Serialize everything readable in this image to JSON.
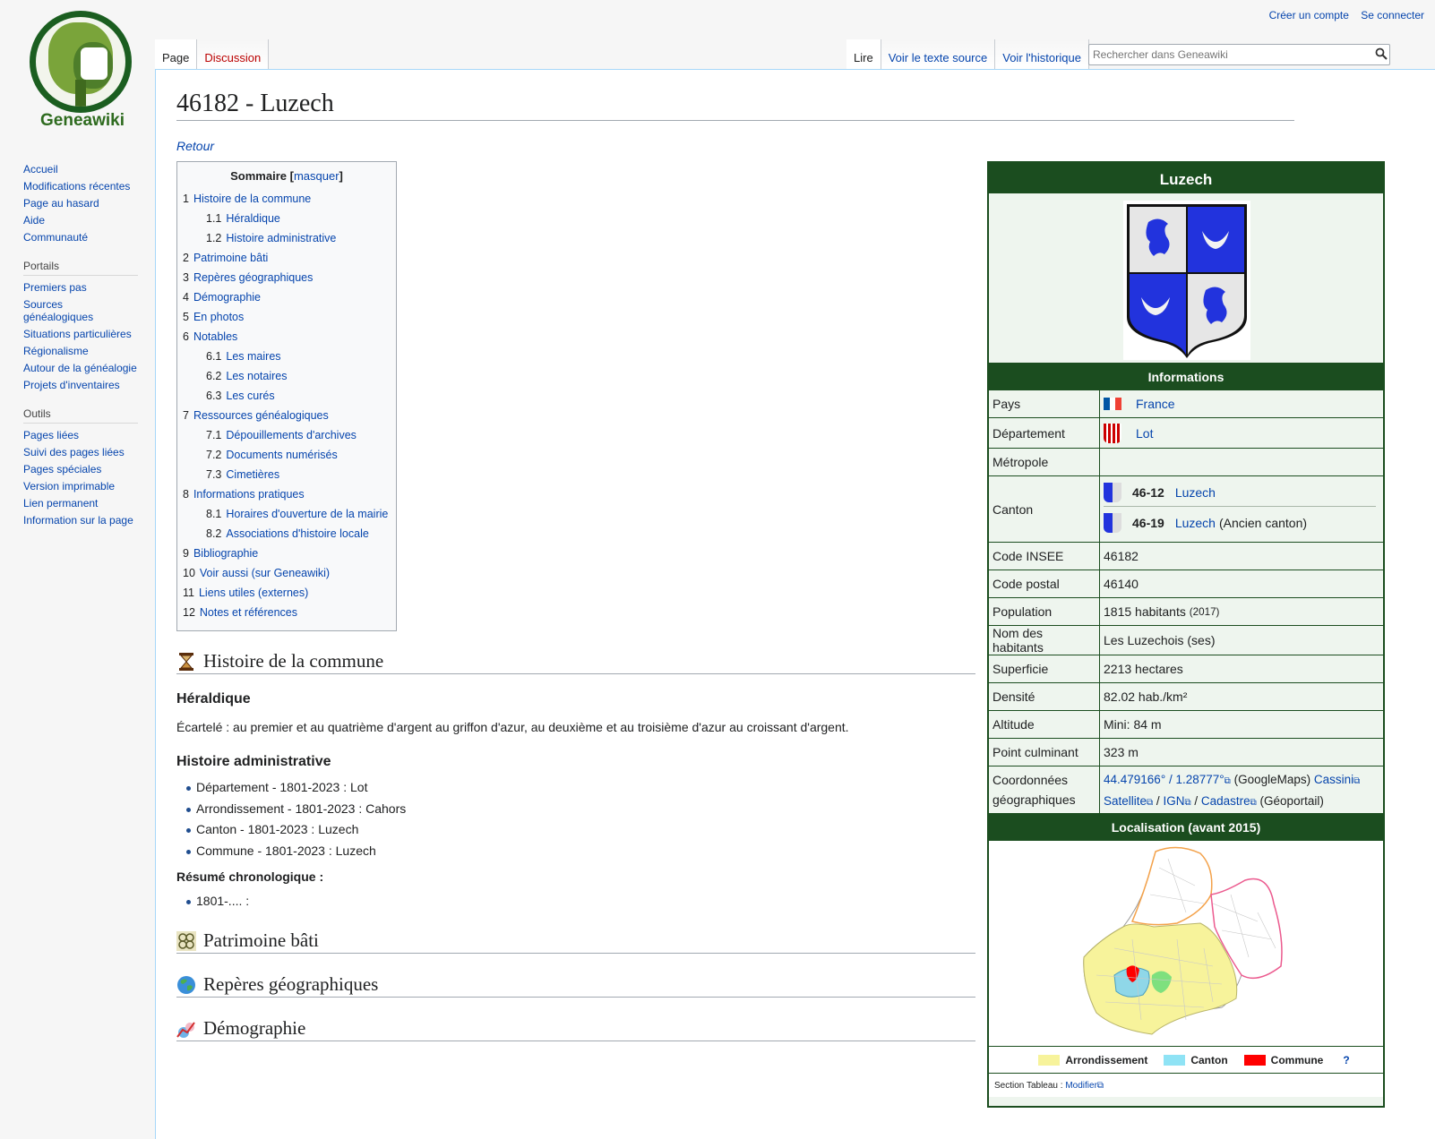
{
  "personal": {
    "create_account": "Créer un compte",
    "login": "Se connecter"
  },
  "logo": {
    "name": "Geneawiki"
  },
  "sidebar": {
    "nav": [
      "Accueil",
      "Modifications récentes",
      "Page au hasard",
      "Aide",
      "Communauté"
    ],
    "portails_title": "Portails",
    "portails": [
      "Premiers pas",
      "Sources généalogiques",
      "Situations particulières",
      "Régionalisme",
      "Autour de la généalogie",
      "Projets d'inventaires"
    ],
    "outils_title": "Outils",
    "outils": [
      "Pages liées",
      "Suivi des pages liées",
      "Pages spéciales",
      "Version imprimable",
      "Lien permanent",
      "Information sur la page"
    ]
  },
  "tabs": {
    "left": [
      "Page",
      "Discussion"
    ],
    "right": [
      "Lire",
      "Voir le texte source",
      "Voir l'historique"
    ]
  },
  "search": {
    "placeholder": "Rechercher dans Geneawiki"
  },
  "page": {
    "title": "46182 - Luzech",
    "retour": "Retour"
  },
  "toc": {
    "title": "Sommaire",
    "hide_label": "masquer",
    "entries": [
      {
        "num": "1",
        "label": "Histoire de la commune",
        "level": 1
      },
      {
        "num": "1.1",
        "label": "Héraldique",
        "level": 2
      },
      {
        "num": "1.2",
        "label": "Histoire administrative",
        "level": 2
      },
      {
        "num": "2",
        "label": "Patrimoine bâti",
        "level": 1
      },
      {
        "num": "3",
        "label": "Repères géographiques",
        "level": 1
      },
      {
        "num": "4",
        "label": "Démographie",
        "level": 1
      },
      {
        "num": "5",
        "label": "En photos",
        "level": 1
      },
      {
        "num": "6",
        "label": "Notables",
        "level": 1
      },
      {
        "num": "6.1",
        "label": "Les maires",
        "level": 2
      },
      {
        "num": "6.2",
        "label": "Les notaires",
        "level": 2
      },
      {
        "num": "6.3",
        "label": "Les curés",
        "level": 2
      },
      {
        "num": "7",
        "label": "Ressources généalogiques",
        "level": 1
      },
      {
        "num": "7.1",
        "label": "Dépouillements d'archives",
        "level": 2
      },
      {
        "num": "7.2",
        "label": "Documents numérisés",
        "level": 2
      },
      {
        "num": "7.3",
        "label": "Cimetières",
        "level": 2
      },
      {
        "num": "8",
        "label": "Informations pratiques",
        "level": 1
      },
      {
        "num": "8.1",
        "label": "Horaires d'ouverture de la mairie",
        "level": 2
      },
      {
        "num": "8.2",
        "label": "Associations d'histoire locale",
        "level": 2
      },
      {
        "num": "9",
        "label": "Bibliographie",
        "level": 1
      },
      {
        "num": "10",
        "label": "Voir aussi (sur Geneawiki)",
        "level": 1
      },
      {
        "num": "11",
        "label": "Liens utiles (externes)",
        "level": 1
      },
      {
        "num": "12",
        "label": "Notes et références",
        "level": 1
      }
    ]
  },
  "sections": {
    "histoire": "Histoire de la commune",
    "heraldique_title": "Héraldique",
    "heraldique_text": "Écartelé : au premier et au quatrième d'argent au griffon d'azur, au deuxième et au troisième d'azur au croissant d'argent.",
    "admin_title": "Histoire administrative",
    "admin_items": [
      "Département - 1801-2023 : Lot",
      "Arrondissement - 1801-2023 : Cahors",
      "Canton - 1801-2023 : Luzech",
      "Commune - 1801-2023 : Luzech"
    ],
    "resume_title": "Résumé chronologique :",
    "resume_items": [
      "1801-.... :"
    ],
    "patrimoine": "Patrimoine bâti",
    "reperes": "Repères géographiques",
    "demographie": "Démographie"
  },
  "infobox": {
    "title": "Luzech",
    "info_title": "Informations",
    "pays_label": "Pays",
    "pays_value": "France",
    "dept_label": "Département",
    "dept_value": "Lot",
    "metropole_label": "Métropole",
    "canton_label": "Canton",
    "canton1_code": "46-12",
    "canton1_name": "Luzech",
    "canton2_code": "46-19",
    "canton2_name": "Luzech",
    "canton2_note": "(Ancien canton)",
    "insee_label": "Code INSEE",
    "insee_value": "46182",
    "postal_label": "Code postal",
    "postal_value": "46140",
    "pop_label": "Population",
    "pop_value": "1815 habitants",
    "pop_year": "(2017)",
    "nom_label": "Nom des habitants",
    "nom_value": "Les Luzechois (ses)",
    "superficie_label": "Superficie",
    "superficie_value": "2213 hectares",
    "densite_label": "Densité",
    "densite_value": "82.02 hab./km²",
    "altitude_label": "Altitude",
    "altitude_value": "Mini: 84 m",
    "culminant_label": "Point culminant",
    "culminant_value": "323 m",
    "coord_label": "Coordonnées géographiques",
    "coord_value": "44.479166° / 1.28777°",
    "coord_googlemaps": "(GoogleMaps)",
    "coord_cassini": "Cassini",
    "coord_satellite": "Satellite",
    "coord_ign": "IGN",
    "coord_cadastre": "Cadastre",
    "coord_geoportail": "(Géoportail)",
    "loc_title": "Localisation (avant 2015)",
    "legend_arr": "Arrondissement",
    "legend_canton": "Canton",
    "legend_commune": "Commune",
    "legend_help": "?",
    "section_tableau": "Section Tableau :",
    "modifier": "Modifier"
  },
  "colors": {
    "infobox_green": "#1b4d1f",
    "link": "#0645ad",
    "arr": "#f7f39b",
    "canton": "#8fe3f5",
    "commune": "#ff0000"
  }
}
